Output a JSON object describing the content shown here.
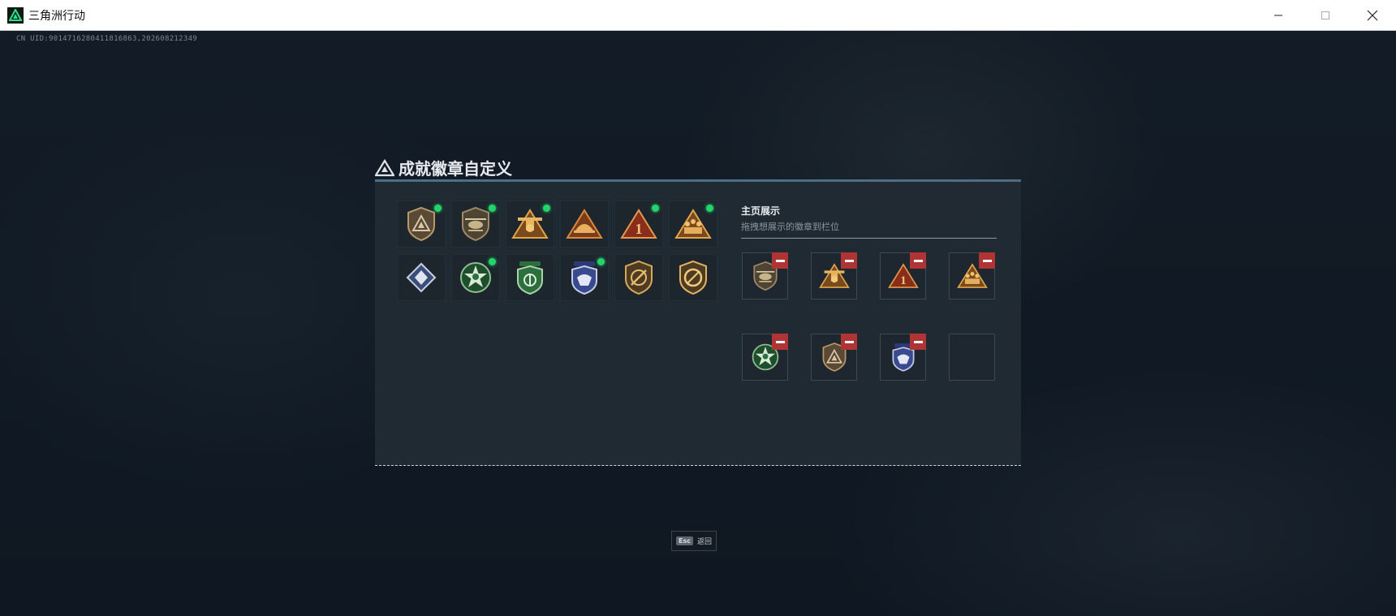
{
  "window": {
    "title": "三角洲行动",
    "controls": [
      "minimize",
      "maximize",
      "close"
    ]
  },
  "uid_text": "CN UID:9014716280411816863,202608212349",
  "panel": {
    "title": "成就徽章自定义",
    "badges": [
      {
        "icon": "bronze-shield-delta-badge",
        "new": true
      },
      {
        "icon": "helicopter-shield-badge",
        "new": true
      },
      {
        "icon": "gold-triangle-tower-badge",
        "new": true
      },
      {
        "icon": "orange-triangle-dome-badge",
        "new": false
      },
      {
        "icon": "red-triangle-number-one-badge",
        "new": true
      },
      {
        "icon": "gold-triangle-soldiers-badge",
        "new": true
      },
      {
        "icon": "blue-diamond-gem-badge",
        "new": false
      },
      {
        "icon": "green-star-wreath-badge",
        "new": true
      },
      {
        "icon": "green-shield-emblem-badge",
        "new": false
      },
      {
        "icon": "blue-police-eagle-badge",
        "new": true
      },
      {
        "icon": "gold-shield-slash-badge",
        "new": false
      },
      {
        "icon": "gold-shield-ring-badge",
        "new": false
      }
    ],
    "showcase": {
      "heading": "主页展示",
      "subheading": "拖拽想展示的徽章到栏位",
      "slots": [
        {
          "icon": "helicopter-shield-badge",
          "filled": true
        },
        {
          "icon": "gold-triangle-tower-badge",
          "filled": true
        },
        {
          "icon": "red-triangle-number-one-badge",
          "filled": true
        },
        {
          "icon": "gold-triangle-soldiers-badge",
          "filled": true
        },
        {
          "icon": "green-star-wreath-badge",
          "filled": true
        },
        {
          "icon": "bronze-shield-delta-badge",
          "filled": true
        },
        {
          "icon": "blue-police-eagle-badge",
          "filled": true
        },
        {
          "icon": "empty",
          "filled": false
        }
      ]
    }
  },
  "footer": {
    "esc_key": "Esc",
    "back_label": "返回"
  },
  "colors": {
    "new_dot": "#22d46a",
    "remove": "#b03434",
    "panel_top": "#4d6f86"
  }
}
